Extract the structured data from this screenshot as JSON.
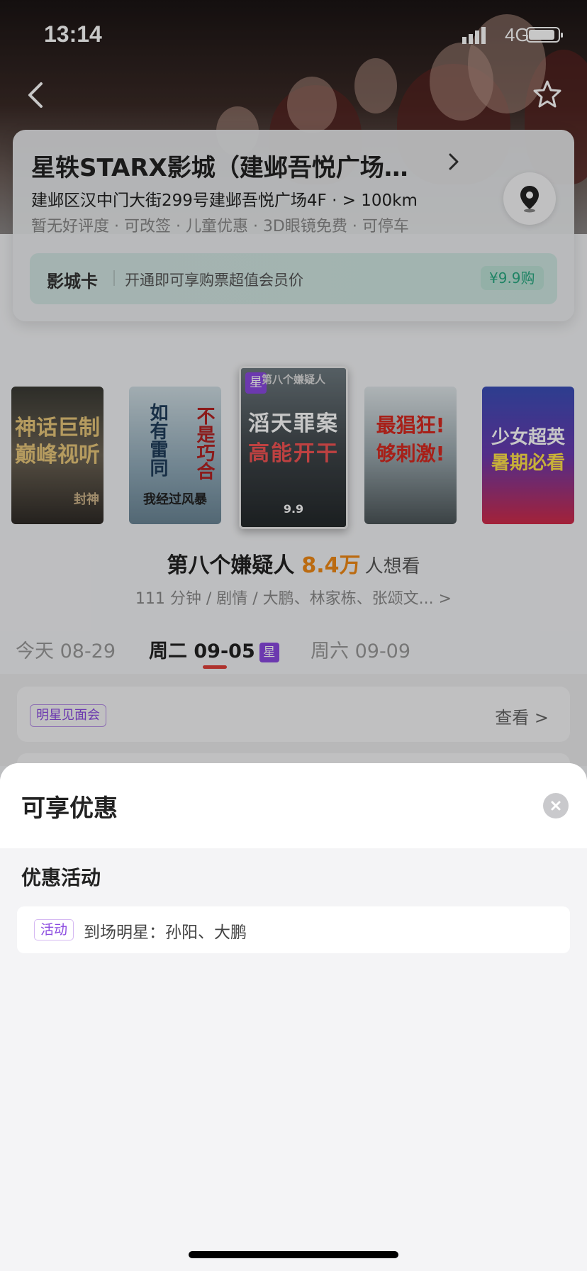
{
  "status_bar": {
    "time": "13:14",
    "network": "4G"
  },
  "cinema": {
    "name": "星轶STARX影城（建邺吾悦广场…",
    "address": "建邺区汉中门大街299号建邺吾悦广场4F · > 100km",
    "tags": "暂无好评度 · 可改签 · 儿童优惠 · 3D眼镜免费 · 可停车"
  },
  "member_card": {
    "title": "影城卡",
    "description": "开通即可享购票超值会员价",
    "price": "¥9.9购"
  },
  "posters": [
    {
      "line1": "神话巨制",
      "line2": "巅峰视听",
      "extra": "封神"
    },
    {
      "line1": "如有雷同",
      "line2": "不是巧合",
      "extra": "我经过风暴"
    },
    {
      "line1": "滔天罪案",
      "line2": "高能开干",
      "extra": "第八个嫌疑人",
      "badge": "星",
      "date": "9.9"
    },
    {
      "line1": "最猖狂!",
      "line2": "够刺激!",
      "extra": ""
    },
    {
      "line1": "少女超英",
      "line2": "暑期必看",
      "extra": ""
    }
  ],
  "movie": {
    "title": "第八个嫌疑人",
    "score": "8.4万",
    "want_label": "人想看",
    "info": "111 分钟 / 剧情 / 大鹏、林家栋、张颂文... >"
  },
  "dates": [
    {
      "label": "今天 08-29"
    },
    {
      "label": "周二 09-05",
      "badge": "星"
    },
    {
      "label": "周六 09-09"
    }
  ],
  "star_meet": {
    "badge": "明星见面会",
    "action": "查看 >"
  },
  "sheet": {
    "title": "可享优惠",
    "section_title": "优惠活动",
    "promo_tag": "活动",
    "promo_text": "到场明星：孙阳、大鹏"
  },
  "colors": {
    "accent_purple": "#8b4ae0",
    "score_orange": "#f08a16",
    "underline_red": "#e0403a",
    "member_green": "#2aa982"
  }
}
